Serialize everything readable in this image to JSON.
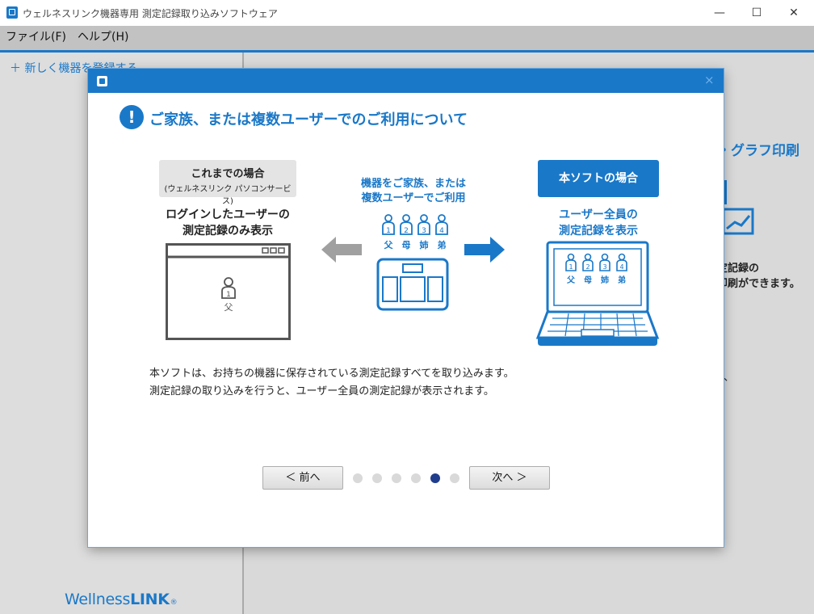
{
  "window": {
    "title": "ウェルネスリンク機器専用 測定記録取り込みソフトウェア",
    "minimize": "—",
    "maximize": "☐",
    "close": "✕"
  },
  "menu": [
    "ファイル(F)",
    "ヘルプ(H)"
  ],
  "sidebar": {
    "add_device": "＋ 新しく機器を登録する"
  },
  "background": {
    "heading_fragment": "・グラフ印刷",
    "text_line1": "定記録の",
    "text_line2": "印刷ができます。",
    "comma": "、"
  },
  "brand": {
    "name_regular": "Wellness",
    "name_bold": "LINK",
    "registered": "®"
  },
  "dialog": {
    "close_label": "×",
    "info_mark": "!",
    "title": "ご家族、または複数ユーザーでのご利用について",
    "before": {
      "label": "これまでの場合",
      "sublabel": "(ウェルネスリンク パソコンサービス)",
      "desc_line1": "ログインしたユーザーの",
      "desc_line2": "測定記録のみ表示",
      "user_number": "1",
      "user_label": "父"
    },
    "center": {
      "caption_line1": "機器をご家族、または",
      "caption_line2": "複数ユーザーでご利用",
      "people": [
        {
          "number": "1",
          "label": "父"
        },
        {
          "number": "2",
          "label": "母"
        },
        {
          "number": "3",
          "label": "姉"
        },
        {
          "number": "4",
          "label": "弟"
        }
      ]
    },
    "after": {
      "label": "本ソフトの場合",
      "desc_line1": "ユーザー全員の",
      "desc_line2": "測定記録を表示"
    },
    "body_line1": "本ソフトは、お持ちの機器に保存されている測定記録すべてを取り込みます。",
    "body_line2": "測定記録の取り込みを行うと、ユーザー全員の測定記録が表示されます。",
    "prev_label": "＜ 前へ",
    "next_label": "次へ ＞",
    "pagination": {
      "total": 6,
      "current": 5
    },
    "colors": {
      "accent": "#1a78c8",
      "active_dot": "#1f3d8c",
      "inactive_dot": "#d9d9d9",
      "arrow_gray": "#a0a0a0"
    }
  }
}
